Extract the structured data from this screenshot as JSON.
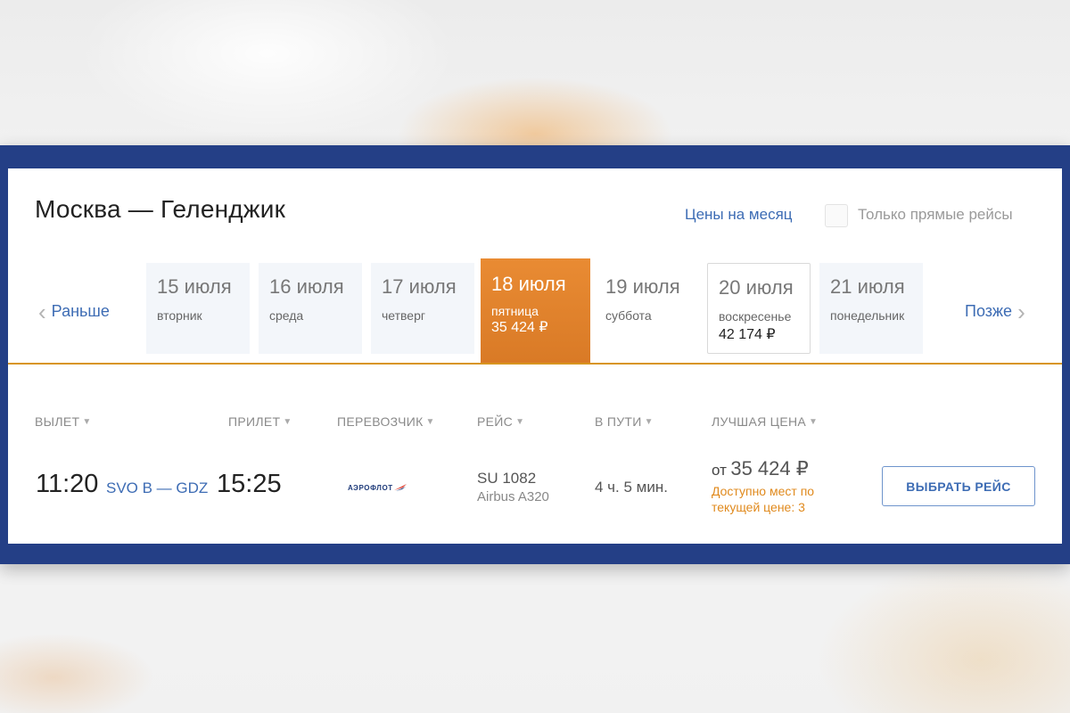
{
  "header": {
    "route_title": "Москва — Геленджик",
    "month_prices_link": "Цены на месяц",
    "direct_only_label": "Только прямые рейсы",
    "direct_only_checked": false
  },
  "date_nav": {
    "earlier_label": "Раньше",
    "later_label": "Позже",
    "days": [
      {
        "date": "15 июля",
        "weekday": "вторник",
        "price": ""
      },
      {
        "date": "16 июля",
        "weekday": "среда",
        "price": ""
      },
      {
        "date": "17 июля",
        "weekday": "четверг",
        "price": ""
      },
      {
        "date": "18 июля",
        "weekday": "пятница",
        "price": "35 424 ₽",
        "selected": true
      },
      {
        "date": "19 июля",
        "weekday": "суббота",
        "price": ""
      },
      {
        "date": "20 июля",
        "weekday": "воскресенье",
        "price": "42 174 ₽"
      },
      {
        "date": "21 июля",
        "weekday": "понедельник",
        "price": ""
      }
    ]
  },
  "columns": {
    "departure": "ВЫЛЕТ",
    "arrival": "ПРИЛЕТ",
    "carrier": "ПЕРЕВОЗЧИК",
    "flight": "РЕЙС",
    "duration": "В ПУТИ",
    "best_price": "ЛУЧШАЯ ЦЕНА"
  },
  "flight": {
    "departure_time": "11:20",
    "route_codes": "SVO B — GDZ",
    "arrival_time": "15:25",
    "carrier_logo_text": "АЭРОФЛОТ",
    "flight_number": "SU 1082",
    "aircraft": "Airbus A320",
    "duration": "4 ч. 5 мин.",
    "price_prefix": "от",
    "price": "35 424 ₽",
    "seats_note": "Доступно мест по текущей цене: 3",
    "select_button": "ВЫБРАТЬ РЕЙС"
  },
  "colors": {
    "frame": "#243f86",
    "accent_orange": "#e08a1e",
    "link_blue": "#3d6cb4"
  }
}
